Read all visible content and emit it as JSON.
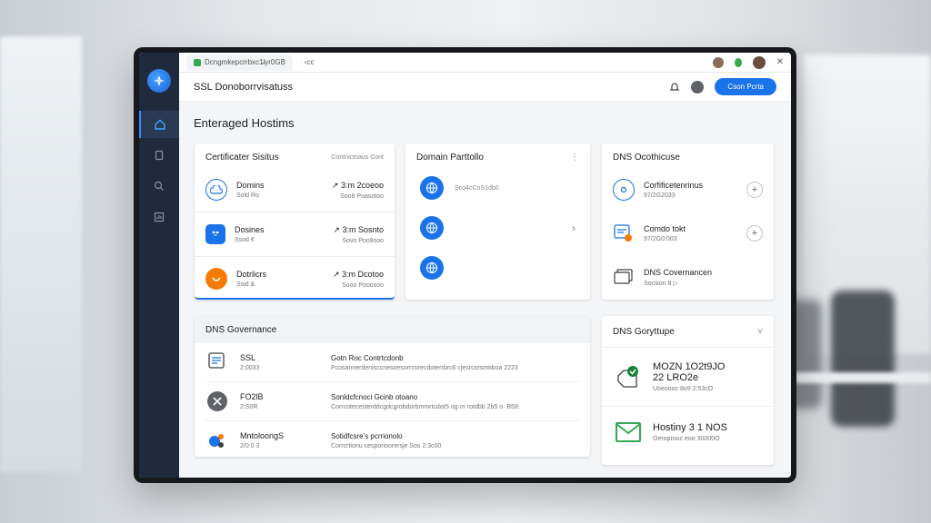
{
  "browser": {
    "tab_title": "Dcngmkepcrrbxc1̶lyr0GB",
    "address": "· ‹cc"
  },
  "header": {
    "title": "SSL  Donoborrvisatuss",
    "cta_label": "Cson Pcrta"
  },
  "page": {
    "title": "Enteraged Hostims"
  },
  "cert_status": {
    "title": "Certificater Sisitus",
    "link": "Contnictoaus  Cont",
    "items": [
      {
        "name": "Domins",
        "sub": "Sold Ro",
        "value": "↗ 3:m 2coeoo",
        "value_sub": "Soo8 Poasotoo"
      },
      {
        "name": "Dosines",
        "sub": "Ssod €",
        "value": "↗ 3:m Sosnto",
        "value_sub": "Sovo Poo9soo"
      },
      {
        "name": "Dotrlicrs",
        "sub": "Ssid &",
        "value": "↗ 3:m Dcotoo",
        "value_sub": "Sooo Pooosoo"
      }
    ]
  },
  "domain_portfolio": {
    "title": "Domain Parttollo",
    "menu": "⋮",
    "items": [
      {
        "label": "Sco4cCoS1db0"
      },
      {
        "label": ""
      },
      {
        "label": ""
      }
    ],
    "chevron": "›"
  },
  "dns_cont": {
    "title": "DNS Ocothicuse",
    "items": [
      {
        "name": "Corfificetenrinus",
        "sub": "97/2G2033"
      },
      {
        "name": "Comdo tokt",
        "sub": "97/2G0:003"
      },
      {
        "name": "DNS Covernancen",
        "sub": "Sociiion 8 ▷"
      }
    ]
  },
  "dns_governance": {
    "title": "DNS Governance",
    "rows": [
      {
        "name": "SSL",
        "sub": "2:0033",
        "title": "Gotn Roc Contrtcdonb",
        "desc": "Pcosannerdenisccnesoesorrcorecdoterrbrc6 cjesrcorsmtiboa 2223"
      },
      {
        "name": "FO2lB",
        "sub": "2:S0R",
        "title": "Sonldcfcnoci Gcinb otoano",
        "desc": "Corrcotecesterddcgdcgrobdorbmmrtcdor5 og·m rotdbb 2b5 o· B59:"
      },
      {
        "name": "MntoloongS",
        "sub": "2/0:0 3",
        "title": "Sotidfcsre’s pcrrionolo",
        "desc": "Corrcrtionu cesporioorersje Sos 2:3c00"
      }
    ]
  },
  "dns_group": {
    "title": "DNS Goryttupe",
    "chevron": "˅",
    "stat1": {
      "title": "MOZN 1O2t9JO",
      "title2": "22 LRO2e",
      "sub": "Uoeoooc 8o9 2:53cO"
    },
    "stat2": {
      "title": "Hostiny 3 1 NOS",
      "sub": "Oeroprooc eoo 30000O"
    }
  },
  "colors": {
    "accent": "#1a73e8",
    "sidebar": "#1f2a3d",
    "success": "#188038",
    "warning": "#f57c00"
  }
}
